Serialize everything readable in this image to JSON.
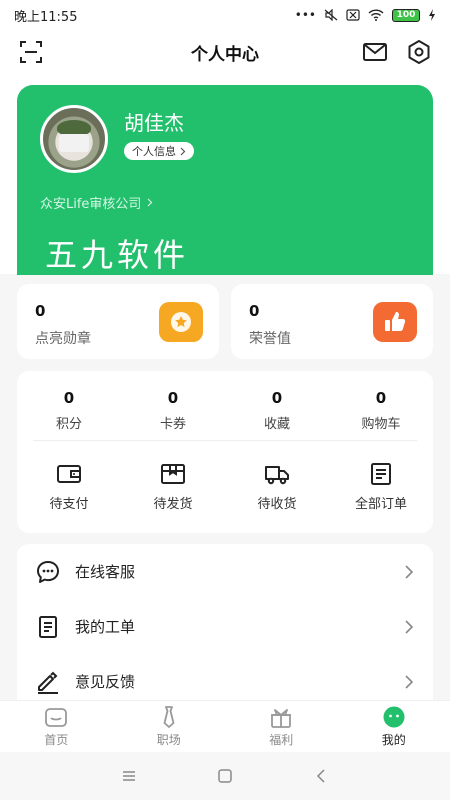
{
  "status_bar": {
    "time": "晚上11:55",
    "battery": "100"
  },
  "header": {
    "title": "个人中心"
  },
  "profile": {
    "name": "胡佳杰",
    "info_button": "个人信息",
    "company": "众安Life审核公司",
    "watermark": "五九软件"
  },
  "highlights": [
    {
      "value": "0",
      "label": "点亮勋章",
      "icon": "medal-icon",
      "color": "#f7a823"
    },
    {
      "value": "0",
      "label": "荣誉值",
      "icon": "thumbs-up-icon",
      "color": "#f36b33"
    }
  ],
  "stats": [
    {
      "value": "0",
      "label": "积分"
    },
    {
      "value": "0",
      "label": "卡券"
    },
    {
      "value": "0",
      "label": "收藏"
    },
    {
      "value": "0",
      "label": "购物车"
    }
  ],
  "orders": [
    {
      "label": "待支付",
      "icon": "wallet-icon"
    },
    {
      "label": "待发货",
      "icon": "package-icon"
    },
    {
      "label": "待收货",
      "icon": "truck-icon"
    },
    {
      "label": "全部订单",
      "icon": "receipt-icon"
    }
  ],
  "menu": [
    {
      "label": "在线客服",
      "icon": "chat-icon"
    },
    {
      "label": "我的工单",
      "icon": "document-icon"
    },
    {
      "label": "意见反馈",
      "icon": "edit-icon"
    }
  ],
  "tabs": [
    {
      "label": "首页",
      "icon": "home-icon",
      "active": false
    },
    {
      "label": "职场",
      "icon": "tie-icon",
      "active": false
    },
    {
      "label": "福利",
      "icon": "gift-icon",
      "active": false
    },
    {
      "label": "我的",
      "icon": "profile-face-icon",
      "active": true
    }
  ],
  "colors": {
    "brand_green": "#22c06d",
    "medal_orange": "#f7a823",
    "honor_orange": "#f36b33"
  }
}
